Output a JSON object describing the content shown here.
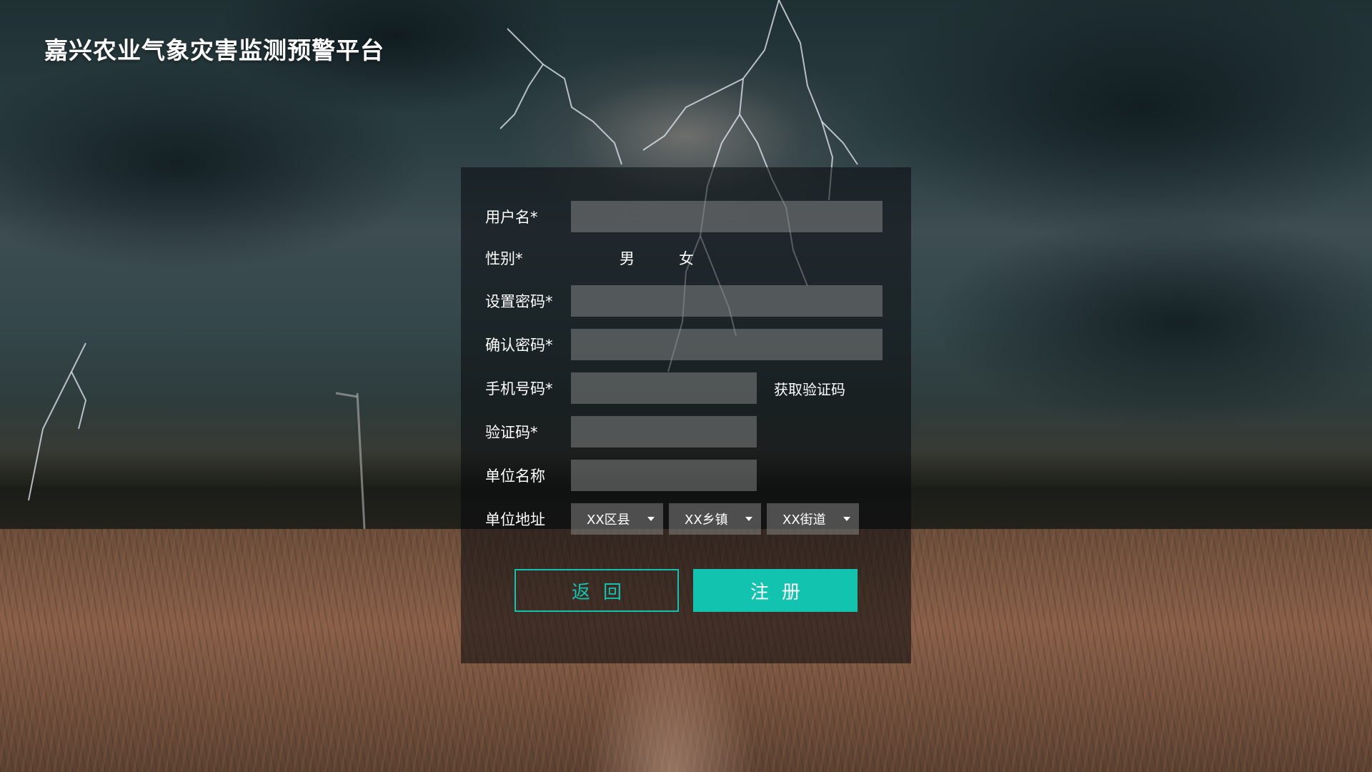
{
  "app": {
    "title": "嘉兴农业气象灾害监测预警平台"
  },
  "form": {
    "username": {
      "label": "用户名*",
      "value": ""
    },
    "gender": {
      "label": "性别*",
      "options": [
        "男",
        "女"
      ]
    },
    "password": {
      "label": "设置密码*",
      "value": ""
    },
    "confirm_password": {
      "label": "确认密码*",
      "value": ""
    },
    "phone": {
      "label": "手机号码*",
      "value": "",
      "get_code_label": "获取验证码"
    },
    "verify_code": {
      "label": "验证码*",
      "value": ""
    },
    "org_name": {
      "label": "单位名称",
      "value": ""
    },
    "org_address": {
      "label": "单位地址",
      "county": "XX区县",
      "town": "XX乡镇",
      "street": "XX街道"
    }
  },
  "buttons": {
    "back": "返回",
    "register": "注册"
  },
  "colors": {
    "accent": "#12c4b0",
    "panel_bg": "rgba(8,10,12,0.55)",
    "field_bg": "rgba(150,150,150,0.45)"
  },
  "icons": {
    "dropdown": "caret-down-icon"
  }
}
